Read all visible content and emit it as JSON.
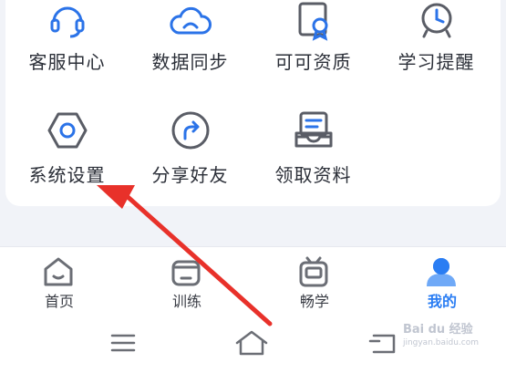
{
  "menu": {
    "row1": [
      {
        "label": "客服中心",
        "icon": "headset-icon"
      },
      {
        "label": "数据同步",
        "icon": "cloud-sync-icon"
      },
      {
        "label": "可可资质",
        "icon": "certificate-icon"
      },
      {
        "label": "学习提醒",
        "icon": "alarm-clock-icon"
      }
    ],
    "row2": [
      {
        "label": "系统设置",
        "icon": "hexagon-settings-icon"
      },
      {
        "label": "分享好友",
        "icon": "share-icon"
      },
      {
        "label": "领取资料",
        "icon": "materials-box-icon"
      }
    ]
  },
  "tabs": [
    {
      "label": "首页",
      "icon": "home-icon",
      "active": false
    },
    {
      "label": "训练",
      "icon": "training-icon",
      "active": false
    },
    {
      "label": "畅学",
      "icon": "radio-icon",
      "active": false
    },
    {
      "label": "我的",
      "icon": "profile-icon",
      "active": true
    }
  ],
  "system_nav": [
    "menu-icon",
    "home-icon",
    "back-icon"
  ],
  "watermark": {
    "brand": "Bai du 经验",
    "url": "jingyan.baidu.com"
  },
  "colors": {
    "icon_blue": "#2b73e8",
    "active_tab": "#2a7df3",
    "text_dark": "#2b2f38",
    "icon_gray": "#6b6e75",
    "arrow_red": "#e8312a"
  }
}
